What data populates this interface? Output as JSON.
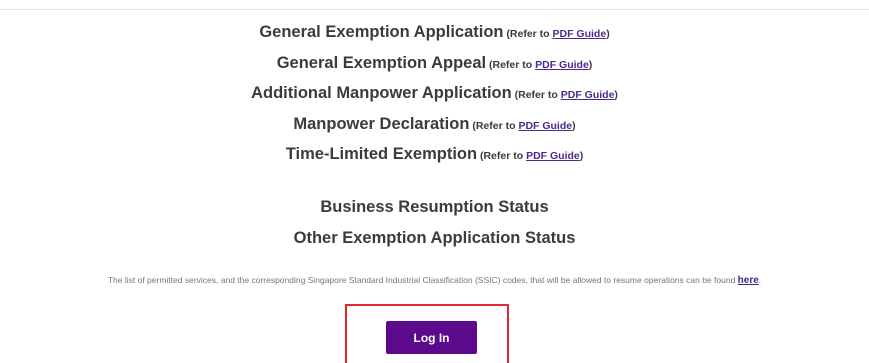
{
  "applications": [
    {
      "label": "General Exemption Application",
      "ref_prefix": " (Refer to ",
      "link_text": "PDF Guide",
      "ref_suffix": ")"
    },
    {
      "label": "General Exemption Appeal",
      "ref_prefix": " (Refer to ",
      "link_text": "PDF Guide",
      "ref_suffix": ")"
    },
    {
      "label": "Additional Manpower Application",
      "ref_prefix": " (Refer to ",
      "link_text": "PDF Guide",
      "ref_suffix": ")"
    },
    {
      "label": "Manpower Declaration",
      "ref_prefix": " (Refer to ",
      "link_text": "PDF Guide",
      "ref_suffix": ")"
    },
    {
      "label": "Time-Limited Exemption",
      "ref_prefix": " (Refer to ",
      "link_text": "PDF Guide",
      "ref_suffix": ")"
    }
  ],
  "status_links": [
    {
      "label": "Business Resumption Status"
    },
    {
      "label": "Other Exemption Application Status"
    }
  ],
  "notice": {
    "text": "The list of permitted services, and the corresponding Singapore Standard Industrial Classification (SSIC) codes, that will be allowed to resume operations can be found ",
    "link_text": "here",
    "suffix": "."
  },
  "login": {
    "label": "Log In"
  },
  "colors": {
    "button_bg": "#5a0a8a",
    "link": "#4b2a8c",
    "highlight_border": "#e5262d"
  }
}
